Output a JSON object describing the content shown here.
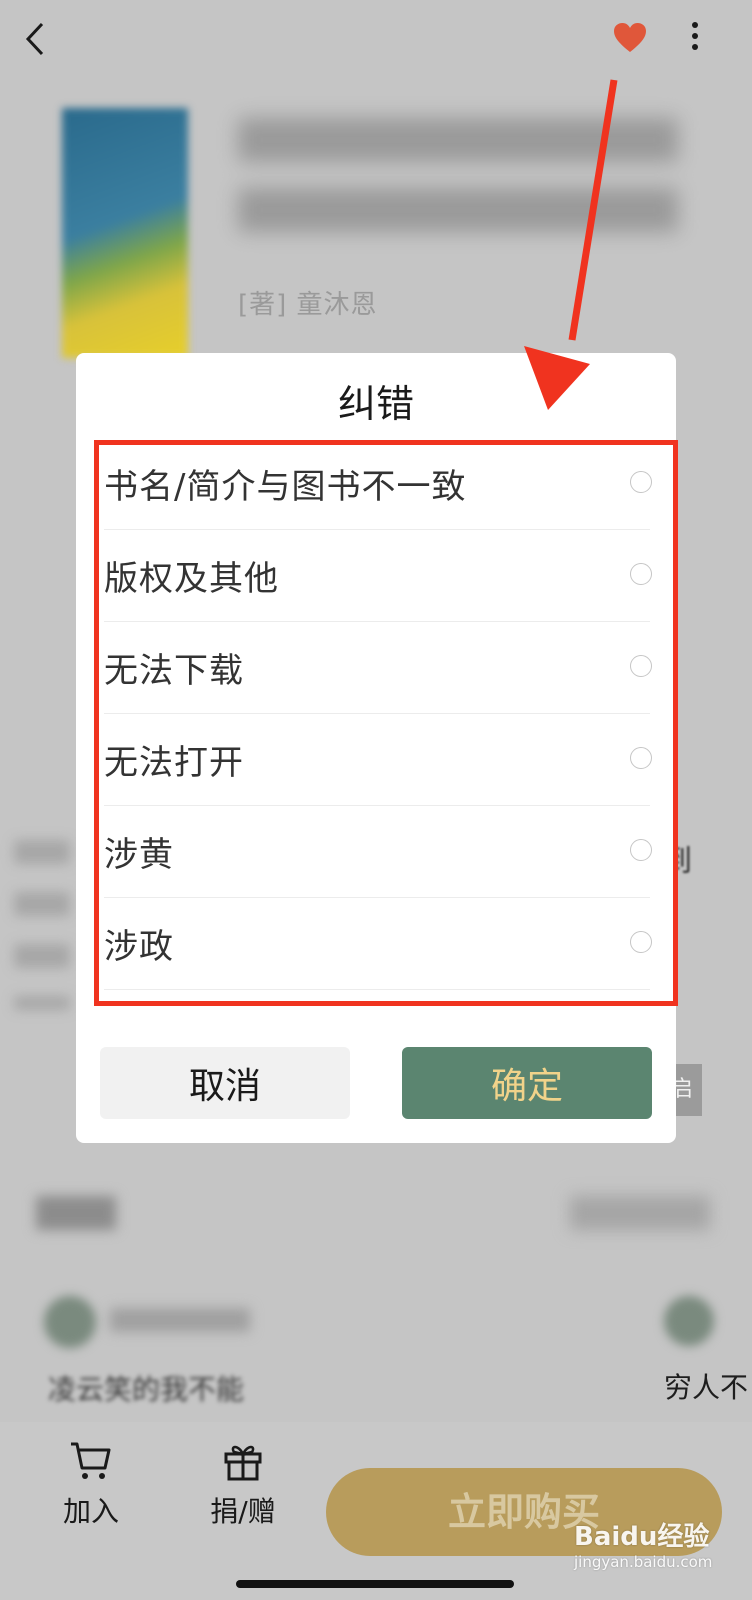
{
  "header": {
    "back_icon": "chevron-left-icon",
    "favorite_icon": "heart-icon",
    "more_icon": "more-vertical-icon",
    "favorite_color": "#e0573a"
  },
  "book": {
    "author": "[著] 童沐恩"
  },
  "background": {
    "right_fragment": "到",
    "tag_fragment": "启",
    "comment_text": "凌云笑的我不能",
    "right_comment_text": "穷人不"
  },
  "dialog": {
    "title": "纠错",
    "options": [
      {
        "label": "书名/简介与图书不一致",
        "selected": false
      },
      {
        "label": "版权及其他",
        "selected": false
      },
      {
        "label": "无法下载",
        "selected": false
      },
      {
        "label": "无法打开",
        "selected": false
      },
      {
        "label": "涉黄",
        "selected": false
      },
      {
        "label": "涉政",
        "selected": false
      }
    ],
    "cancel_label": "取消",
    "confirm_label": "确定",
    "confirm_color": "#5b8570",
    "confirm_text_color": "#f1d38a"
  },
  "bottom_bar": {
    "add_label": "加入",
    "add_icon": "cart-icon",
    "gift_label": "捐/赠",
    "gift_icon": "gift-icon",
    "buy_label": "立即购买"
  },
  "watermark": {
    "brand": "Baidu经验",
    "url": "jingyan.baidu.com"
  },
  "annotation": {
    "color": "#f0331f"
  }
}
